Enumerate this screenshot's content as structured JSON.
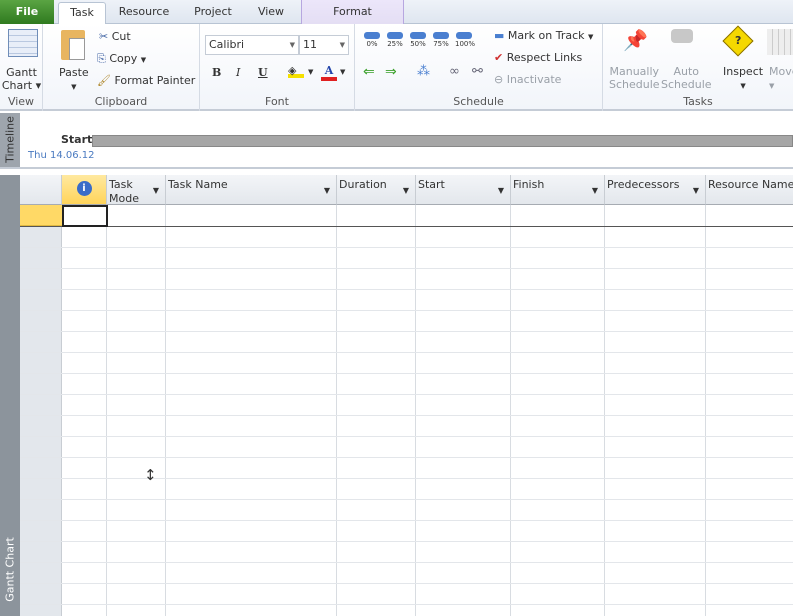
{
  "tabs": {
    "file": "File",
    "task": "Task",
    "resource": "Resource",
    "project": "Project",
    "view": "View",
    "format": "Format"
  },
  "ribbon": {
    "view": {
      "gantt_chart_line1": "Gantt",
      "gantt_chart_line2": "Chart",
      "label": "View"
    },
    "clipboard": {
      "paste": "Paste",
      "cut": "Cut",
      "copy": "Copy",
      "format_painter": "Format Painter",
      "label": "Clipboard"
    },
    "font": {
      "font_name": "Calibri",
      "font_size": "11",
      "bold": "B",
      "italic": "I",
      "underline": "U",
      "font_color": "A",
      "label": "Font"
    },
    "schedule": {
      "percents": [
        "0%",
        "25%",
        "50%",
        "75%",
        "100%"
      ],
      "mark_on_track": "Mark on Track",
      "respect_links": "Respect Links",
      "inactivate": "Inactivate",
      "label": "Schedule"
    },
    "tasks": {
      "manually_line1": "Manually",
      "manually_line2": "Schedule",
      "auto_line1": "Auto",
      "auto_line2": "Schedule",
      "inspect": "Inspect",
      "move": "Move",
      "label": "Tasks"
    }
  },
  "timeline": {
    "side_label": "Timeline",
    "start_label": "Start",
    "start_date": "Thu 14.06.12"
  },
  "view_label": "Gantt Chart",
  "columns": {
    "task_mode_1": "Task",
    "task_mode_2": "Mode",
    "task_name": "Task Name",
    "duration": "Duration",
    "start": "Start",
    "finish": "Finish",
    "predecessors": "Predecessors",
    "resource_names": "Resource Name"
  },
  "colors": {
    "file_tab": "#3d8b2c",
    "selected_row": "#ffd966",
    "accent": "#4a7fd0"
  }
}
